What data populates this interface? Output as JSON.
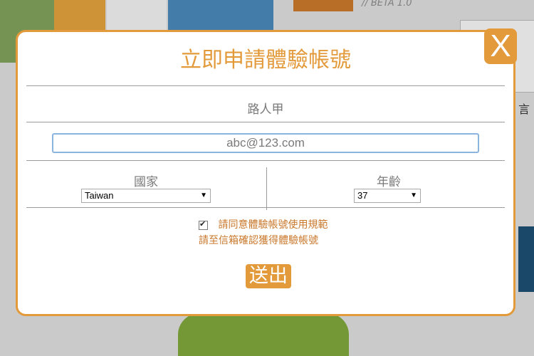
{
  "background": {
    "beta_label": "// BETA 1.0",
    "side_text": "言"
  },
  "modal": {
    "title": "立即申請體驗帳號",
    "close_label": "X",
    "name_value": "路人甲",
    "email_value": "abc@123.com",
    "country_label": "國家",
    "country_value": "Taiwan",
    "age_label": "年齡",
    "age_value": "37",
    "agree_label": "請同意體驗帳號使用規範",
    "confirm_text": "請至信箱確認獲得體驗帳號",
    "submit_label": "送出"
  },
  "colors": {
    "accent": "#e39a3b",
    "text_gray": "#7a7a7a",
    "input_border": "#8bb4de"
  }
}
